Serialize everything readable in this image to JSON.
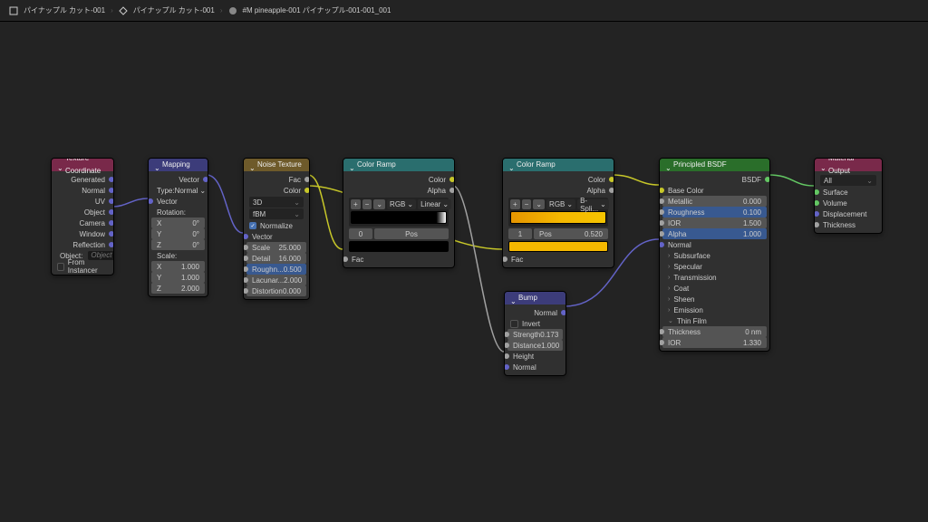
{
  "breadcrumb": {
    "item1": "パイナップル カット-001",
    "item2": "パイナップル カット-001",
    "item3": "#M pineapple-001 パイナップル-001-001_001"
  },
  "nodes": {
    "texcoord": {
      "title": "Texture Coordinate",
      "outputs": [
        "Generated",
        "Normal",
        "UV",
        "Object",
        "Camera",
        "Window",
        "Reflection"
      ],
      "object_label": "Object:",
      "object_placeholder": "Object",
      "from_instancer": "From Instancer"
    },
    "mapping": {
      "title": "Mapping",
      "output": "Vector",
      "type_label": "Type:",
      "type_value": "Normal",
      "vector": "Vector",
      "rotation": "Rotation:",
      "scale": "Scale:",
      "rot": {
        "x": {
          "l": "X",
          "v": "0°"
        },
        "y": {
          "l": "Y",
          "v": "0°"
        },
        "z": {
          "l": "Z",
          "v": "0°"
        }
      },
      "scl": {
        "x": {
          "l": "X",
          "v": "1.000"
        },
        "y": {
          "l": "Y",
          "v": "1.000"
        },
        "z": {
          "l": "Z",
          "v": "2.000"
        }
      }
    },
    "noise": {
      "title": "Noise Texture",
      "outputs": {
        "fac": "Fac",
        "color": "Color"
      },
      "dim": "3D",
      "basis": "fBM",
      "normalize": "Normalize",
      "vector": "Vector",
      "props": {
        "scale": {
          "l": "Scale",
          "v": "25.000"
        },
        "detail": {
          "l": "Detail",
          "v": "16.000"
        },
        "rough": {
          "l": "Roughn...",
          "v": "0.500"
        },
        "lacun": {
          "l": "Lacunar...",
          "v": "2.000"
        },
        "distort": {
          "l": "Distortion",
          "v": "0.000"
        }
      }
    },
    "ramp1": {
      "title": "Color Ramp",
      "outputs": {
        "color": "Color",
        "alpha": "Alpha"
      },
      "interp": "RGB",
      "mode": "Linear",
      "pos_label": "Pos",
      "pos_idx": "0",
      "pos_val": "",
      "fac": "Fac"
    },
    "ramp2": {
      "title": "Color Ramp",
      "outputs": {
        "color": "Color",
        "alpha": "Alpha"
      },
      "interp": "RGB",
      "mode": "B-Spli...",
      "pos_label": "Pos",
      "pos_idx": "1",
      "pos_val": "0.520",
      "fac": "Fac"
    },
    "bump": {
      "title": "Bump",
      "output": "Normal",
      "invert": "Invert",
      "props": {
        "strength": {
          "l": "Strength",
          "v": "0.173"
        },
        "distance": {
          "l": "Distance",
          "v": "1.000"
        }
      },
      "height": "Height",
      "normal": "Normal"
    },
    "bsdf": {
      "title": "Principled BSDF",
      "output": "BSDF",
      "basecolor": "Base Color",
      "props": {
        "metallic": {
          "l": "Metallic",
          "v": "0.000"
        },
        "rough": {
          "l": "Roughness",
          "v": "0.100"
        },
        "ior": {
          "l": "IOR",
          "v": "1.500"
        },
        "alpha": {
          "l": "Alpha",
          "v": "1.000"
        }
      },
      "normal": "Normal",
      "groups": [
        "Subsurface",
        "Specular",
        "Transmission",
        "Coat",
        "Sheen",
        "Emission",
        "Thin Film"
      ],
      "thickness": {
        "l": "Thickness",
        "v": "0 nm"
      },
      "ior2": {
        "l": "IOR",
        "v": "1.330"
      }
    },
    "output": {
      "title": "Material Output",
      "target": "All",
      "inputs": [
        "Surface",
        "Volume",
        "Displacement",
        "Thickness"
      ]
    }
  }
}
